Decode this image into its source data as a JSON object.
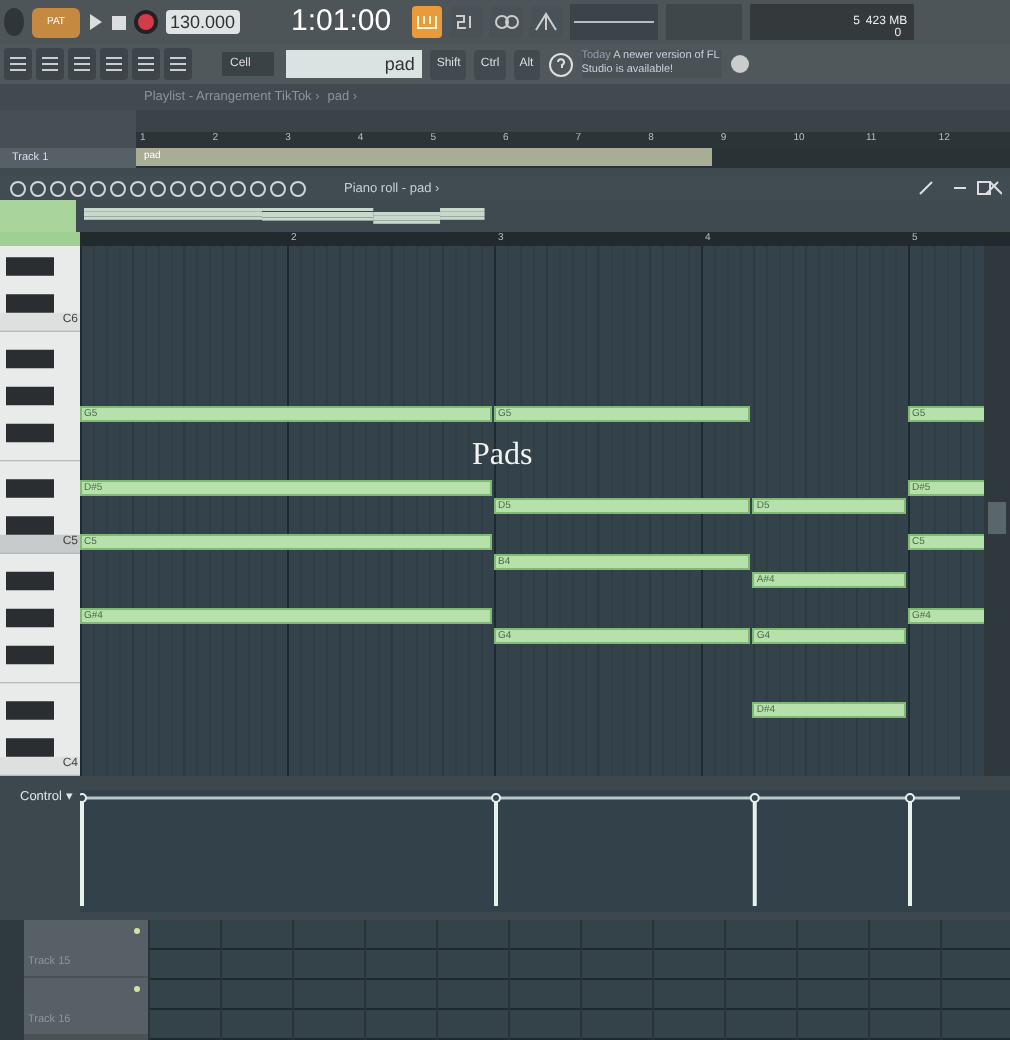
{
  "toolbar": {
    "mode": "PAT",
    "tempo": "130.000",
    "time": "1:01:00",
    "cpu": "5",
    "memory": "423 MB",
    "voices": "0"
  },
  "toolbar2": {
    "snap": "Cell",
    "pattern": "pad",
    "keys": [
      "Shift",
      "Ctrl",
      "Alt"
    ],
    "hint_day": "Today",
    "hint": "A newer version of FL Studio is available!"
  },
  "playlist": {
    "crumbs": [
      "Playlist - Arrangement TikTok ›",
      "pad ›"
    ],
    "ruler": [
      "1",
      "2",
      "3",
      "4",
      "5",
      "6",
      "7",
      "8",
      "9",
      "10",
      "11",
      "12"
    ],
    "track": "Track 1",
    "clip": "pad"
  },
  "piano_roll": {
    "title": "Piano roll - pad ›",
    "ruler": [
      "2",
      "3",
      "4",
      "5"
    ],
    "key_labels": [
      "C6",
      "C5",
      "C4"
    ],
    "caption": "Pads",
    "chords": [
      {
        "notes": [
          "G5",
          "D#5",
          "C5",
          "G#4"
        ]
      },
      {
        "notes": [
          "G5",
          "D5",
          "B4",
          "G4"
        ]
      },
      {
        "notes": [
          "D5",
          "A#4",
          "G4",
          "D#4"
        ]
      },
      {
        "notes": [
          "G5",
          "D#5",
          "C5",
          "G#4"
        ]
      }
    ],
    "control": {
      "label": "Control ▾"
    }
  },
  "tracks": [
    "Track 15",
    "Track 16"
  ]
}
